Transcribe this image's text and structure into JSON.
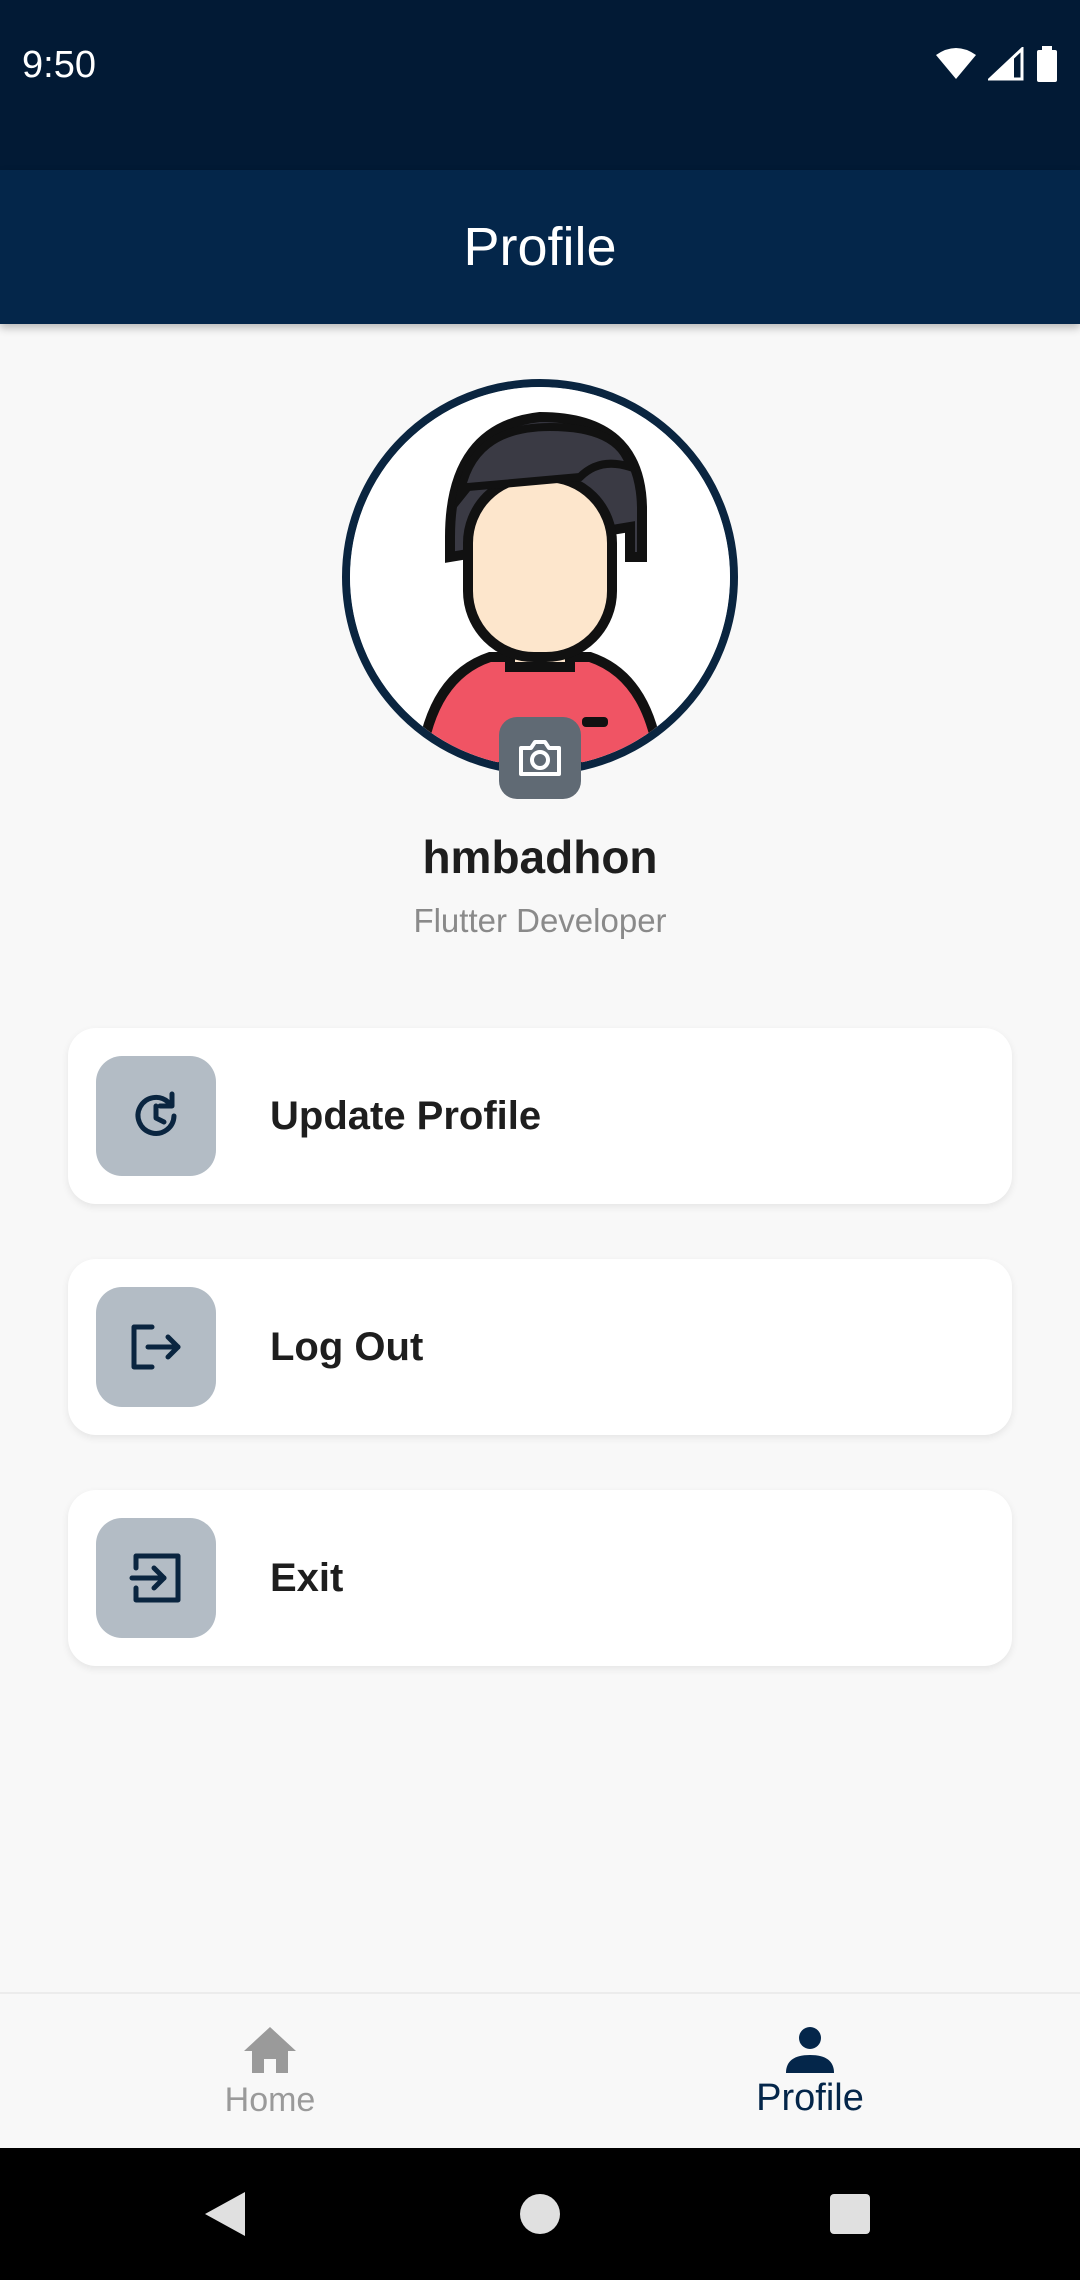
{
  "status_bar": {
    "time": "9:50"
  },
  "app_bar": {
    "title": "Profile"
  },
  "profile": {
    "name": "hmbadhon",
    "role": "Flutter Developer"
  },
  "menu": [
    {
      "label": "Update Profile",
      "icon": "update-icon"
    },
    {
      "label": "Log Out",
      "icon": "logout-icon"
    },
    {
      "label": "Exit",
      "icon": "exit-icon"
    }
  ],
  "bottom_nav": {
    "items": [
      {
        "label": "Home",
        "icon": "home-icon",
        "active": false
      },
      {
        "label": "Profile",
        "icon": "person-icon",
        "active": true
      }
    ]
  },
  "colors": {
    "primary": "#04264a",
    "status_bar": "#021a35",
    "icon_box": "#b3bcc5",
    "background": "#f8f8f8"
  }
}
